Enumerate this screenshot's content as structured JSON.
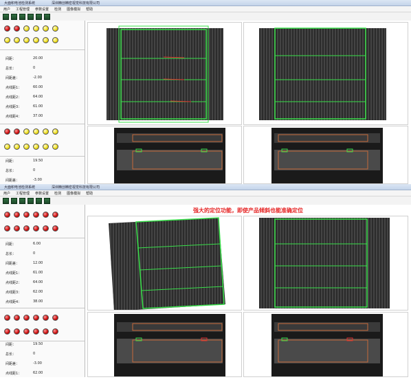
{
  "windows": [
    {
      "title_parts": [
        "大面积电池检测系统",
        "深圳精创精密视觉科技有限公司"
      ],
      "menu": [
        "用户",
        "工程管理",
        "参数设置",
        "检测",
        "图像模拟",
        "帮助"
      ],
      "leds_row1": [
        "red",
        "red",
        "yellow",
        "yellow",
        "yellow",
        "yellow"
      ],
      "leds_row2": [
        "yellow",
        "yellow",
        "yellow",
        "yellow",
        "yellow",
        "yellow"
      ],
      "params": [
        {
          "label": "间距：",
          "value": "20.00"
        },
        {
          "label": "总长：",
          "value": "0"
        },
        {
          "label": "间距差：",
          "value": "-2.00"
        },
        {
          "label": "点线距1：",
          "value": "60.00"
        },
        {
          "label": "点线距2：",
          "value": "64.00"
        },
        {
          "label": "点线距3：",
          "value": "61.00"
        },
        {
          "label": "点线距4：",
          "value": "37.00"
        }
      ],
      "leds_row3": [
        "red",
        "red",
        "yellow",
        "yellow",
        "yellow",
        "yellow"
      ],
      "leds_row4": [
        "yellow",
        "yellow",
        "yellow",
        "yellow",
        "yellow",
        "yellow"
      ],
      "params2": [
        {
          "label": "间距：",
          "value": "19.50"
        },
        {
          "label": "总长：",
          "value": "0"
        },
        {
          "label": "间距差：",
          "value": "-3.00"
        }
      ]
    },
    {
      "title_parts": [
        "大面积电池检测系统",
        "深圳精创精密视觉科技有限公司"
      ],
      "menu": [
        "用户",
        "工程管理",
        "参数设置",
        "检测",
        "图像模拟",
        "帮助"
      ],
      "banner": "强大的定位功能，即使产品倾斜也能准确定位",
      "leds_row1": [
        "red",
        "red",
        "red",
        "red",
        "red",
        "red"
      ],
      "leds_row2": [
        "red",
        "red",
        "red",
        "red",
        "red",
        "red"
      ],
      "params": [
        {
          "label": "间距：",
          "value": "6.00"
        },
        {
          "label": "总长：",
          "value": "0"
        },
        {
          "label": "间距差：",
          "value": "12.00"
        },
        {
          "label": "点线距1：",
          "value": "61.00"
        },
        {
          "label": "点线距2：",
          "value": "64.00"
        },
        {
          "label": "点线距3：",
          "value": "62.00"
        },
        {
          "label": "点线距4：",
          "value": "38.00"
        }
      ],
      "leds_row3": [
        "red",
        "red",
        "red",
        "red",
        "red",
        "red"
      ],
      "leds_row4": [
        "red",
        "red",
        "red",
        "red",
        "red",
        "red"
      ],
      "params2": [
        {
          "label": "间距：",
          "value": "19.50"
        },
        {
          "label": "总长：",
          "value": "0"
        },
        {
          "label": "间距差：",
          "value": "-3.00"
        },
        {
          "label": "点线距1：",
          "value": "62.00"
        }
      ]
    }
  ],
  "colors": {
    "accent_red": "#e52222",
    "detect_green": "#39e04a",
    "led_red": "#d01010",
    "led_yellow": "#f0e020"
  }
}
